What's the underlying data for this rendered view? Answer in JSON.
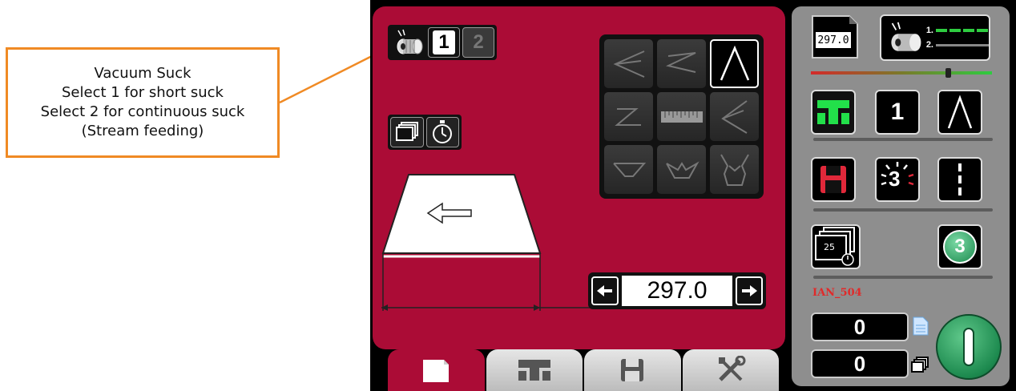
{
  "callout": {
    "line1": "Vacuum Suck",
    "line2": "Select 1 for short suck",
    "line3": "Select 2 for continuous suck",
    "line4": "(Stream feeding)",
    "border_color": "#f08a24"
  },
  "vacuum": {
    "icon": "vacuum-roller-icon",
    "option1": "1",
    "option2": "2"
  },
  "fold_grid": {
    "selected": "gate-fold",
    "icons": [
      "letter-fold-icon",
      "z-fold-icon",
      "single-fold-icon",
      "z-fold-reverse-icon",
      "ruler-icon",
      "letter-fold-reverse-icon",
      "parallel-fold-icon",
      "double-gate-icon",
      "custom-fold-icon"
    ]
  },
  "length": {
    "value": "297.0",
    "left_icon": "arrow-left-icon",
    "right_icon": "arrow-right-icon"
  },
  "tabs": [
    "document-icon",
    "fold-tray-icon",
    "save-icon",
    "tools-icon"
  ],
  "right_panel": {
    "paper_size": "297.0",
    "speed_line1": "1.",
    "speed_line2": "2.",
    "fold_number": "1",
    "batch_number": "3",
    "stack_count": "25",
    "circle_number": "3",
    "job_label": "IAN_504",
    "counter_sheets": "0",
    "counter_stacks": "0"
  },
  "colors": {
    "red_panel": "#ab0c36",
    "grey_panel": "#8e8e8e",
    "green": "#22c55e",
    "start_button": "#1d8a4f"
  }
}
